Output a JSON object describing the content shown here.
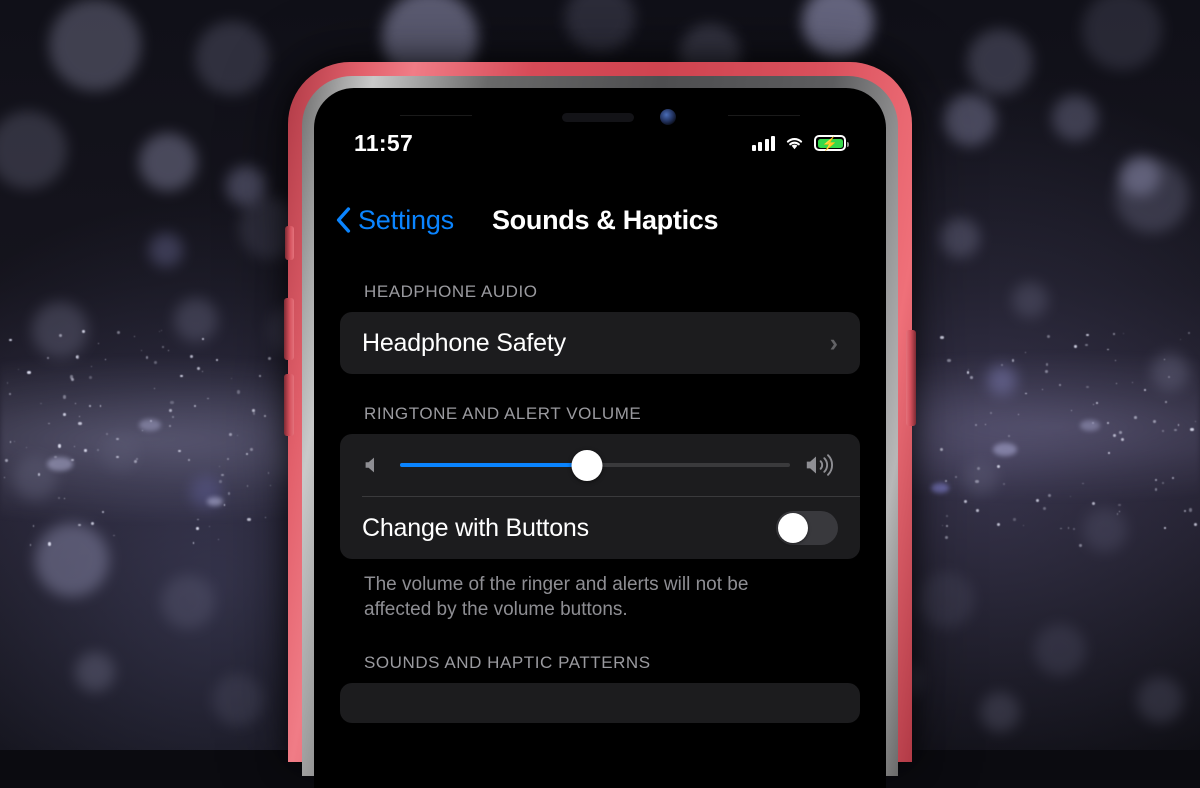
{
  "device": {
    "frame_color": "#d64d59",
    "bezel_color": "#6a6a6a",
    "screen_bg": "#000000"
  },
  "status_bar": {
    "time": "11:57",
    "cellular_icon": "cellular-bars-icon",
    "cellular_bars": 4,
    "wifi_icon": "wifi-icon",
    "battery_icon": "battery-charging-icon",
    "battery_charging": true,
    "battery_color": "#35d94a"
  },
  "nav_bar": {
    "back_icon": "chevron-left-icon",
    "back_label": "Settings",
    "back_color": "#0a84ff",
    "title": "Sounds & Haptics"
  },
  "sections": [
    {
      "header": "HEADPHONE AUDIO",
      "rows": [
        {
          "label": "Headphone Safety",
          "accessory": "chevron-right-icon",
          "accessory_glyph": "›"
        }
      ]
    },
    {
      "header": "RINGTONE AND ALERT VOLUME",
      "slider": {
        "left_icon": "speaker-low-icon",
        "right_icon": "speaker-high-icon",
        "value_percent": 48,
        "fill_color": "#0a84ff",
        "track_color": "#3a3a3c"
      },
      "toggle_row": {
        "label": "Change with Buttons",
        "toggle_state": "off",
        "toggle_track_color": "#39393d"
      },
      "footer": "The volume of the ringer and alerts will not be affected by the volume buttons."
    },
    {
      "header": "SOUNDS AND HAPTIC PATTERNS",
      "rows": []
    }
  ]
}
